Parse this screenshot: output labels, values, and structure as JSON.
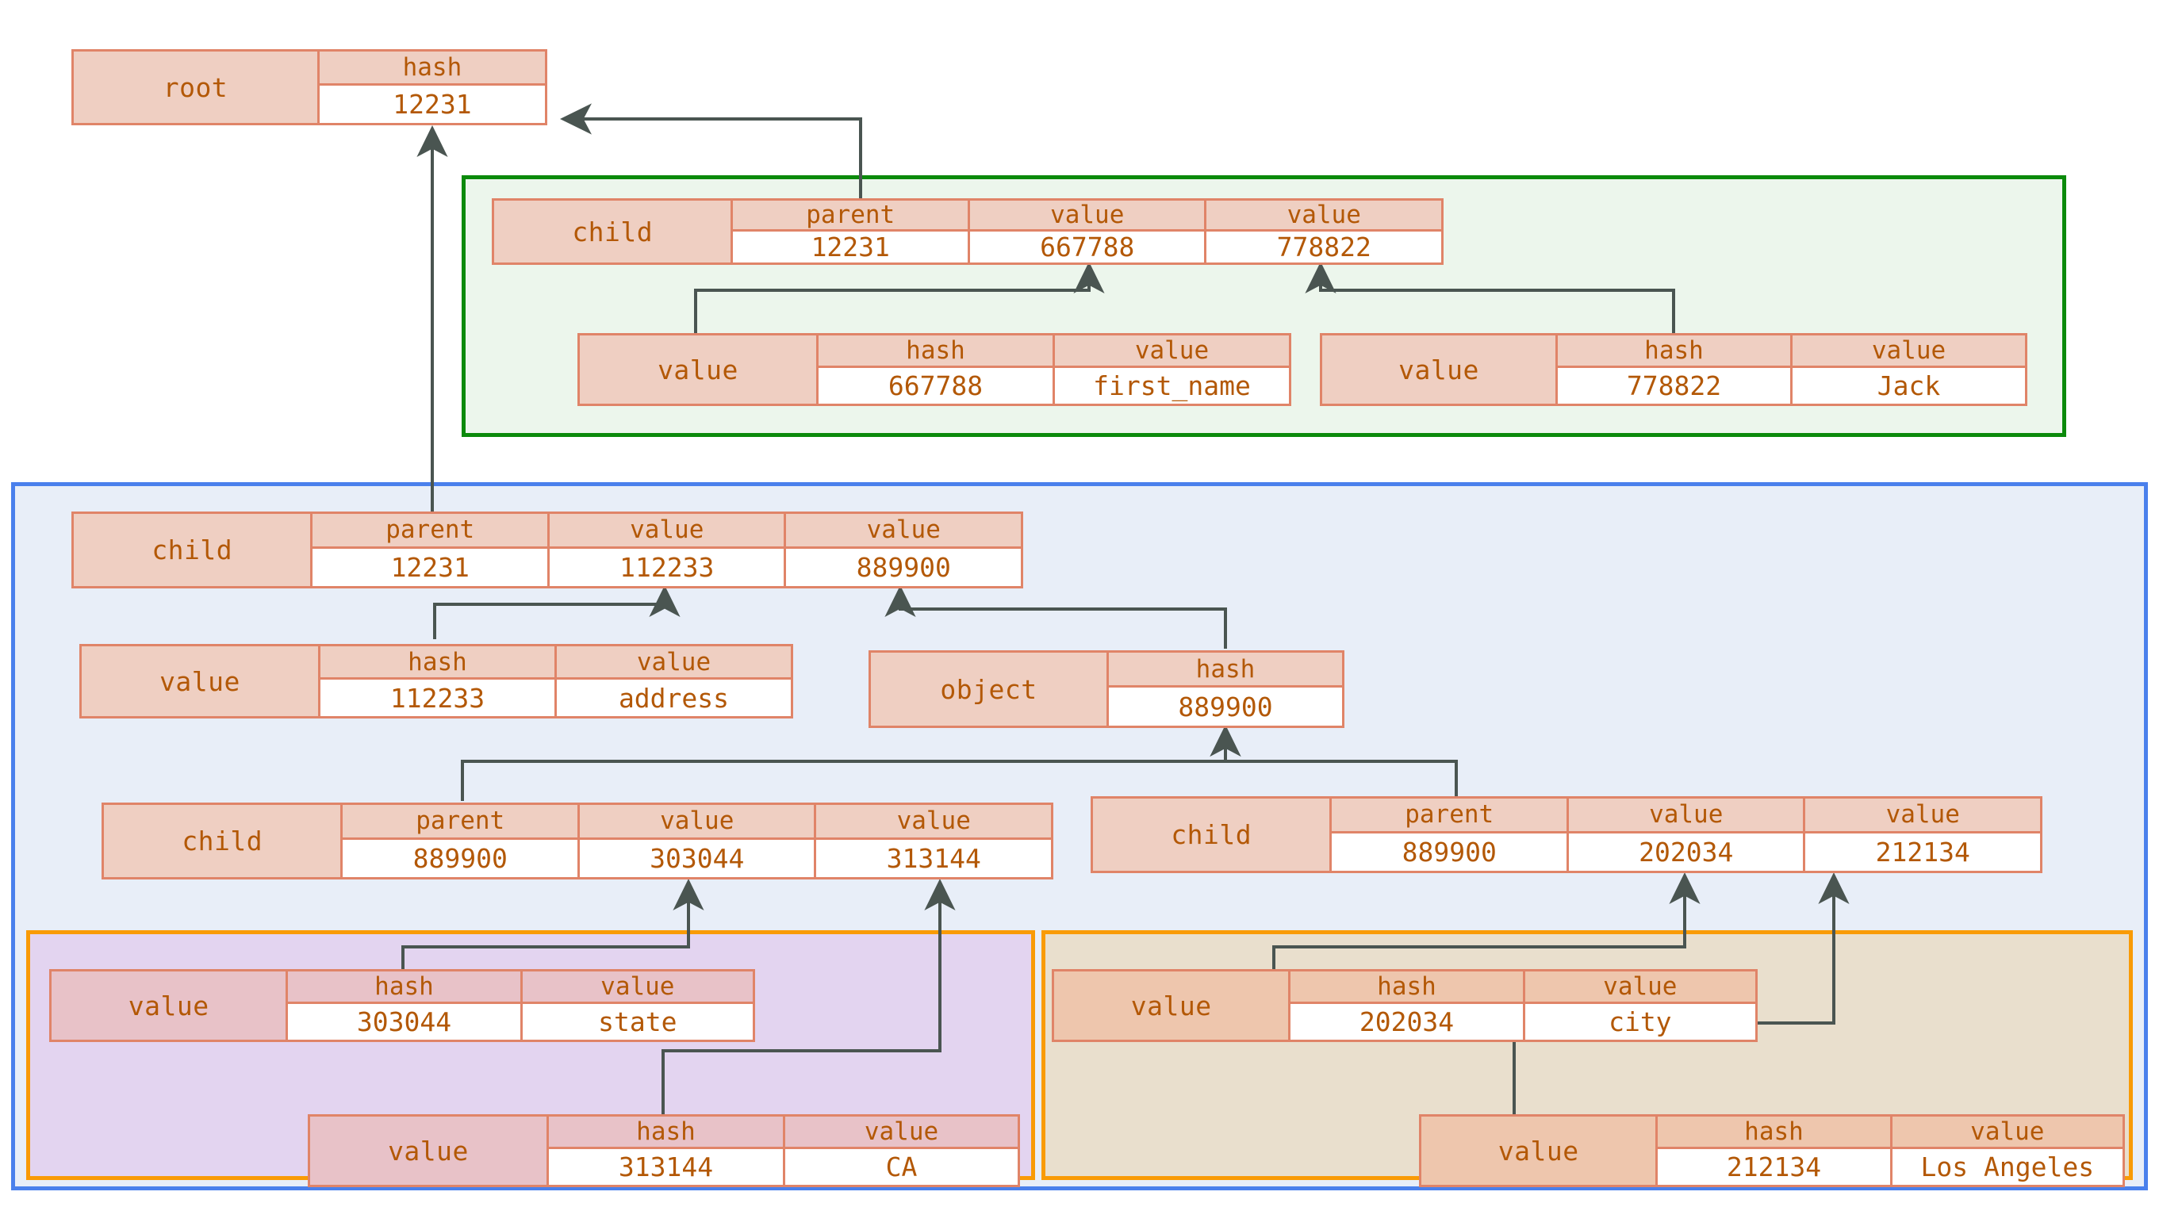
{
  "diagram": {
    "title": "nested-hash-tree-structure",
    "colors": {
      "node_fill": "#efcfc2",
      "node_border": "#e08468",
      "node_text": "#b35806",
      "value_fill": "#ffffff",
      "green_group_border": "#0b8a0b",
      "green_group_fill": "#ecf6ec",
      "blue_group_border": "#4a80ec",
      "blue_group_fill": "#e8eef8",
      "orange_group_border": "#f99b06",
      "purple_group_fill": "#e3d4f0",
      "tan_group_fill": "#e9dfcd",
      "edge_color": "#4a5551"
    },
    "nodes": {
      "root": {
        "label": "root",
        "fields": [
          {
            "key": "hash",
            "value": "12231"
          }
        ]
      },
      "child_first_name": {
        "label": "child",
        "fields": [
          {
            "key": "parent",
            "value": "12231"
          },
          {
            "key": "value",
            "value": "667788"
          },
          {
            "key": "value",
            "value": "778822"
          }
        ]
      },
      "value_first_name_key": {
        "label": "value",
        "fields": [
          {
            "key": "hash",
            "value": "667788"
          },
          {
            "key": "value",
            "value": "first_name"
          }
        ]
      },
      "value_jack": {
        "label": "value",
        "fields": [
          {
            "key": "hash",
            "value": "778822"
          },
          {
            "key": "value",
            "value": "Jack"
          }
        ]
      },
      "child_address": {
        "label": "child",
        "fields": [
          {
            "key": "parent",
            "value": "12231"
          },
          {
            "key": "value",
            "value": "112233"
          },
          {
            "key": "value",
            "value": "889900"
          }
        ]
      },
      "value_address_key": {
        "label": "value",
        "fields": [
          {
            "key": "hash",
            "value": "112233"
          },
          {
            "key": "value",
            "value": "address"
          }
        ]
      },
      "object_address": {
        "label": "object",
        "fields": [
          {
            "key": "hash",
            "value": "889900"
          }
        ]
      },
      "child_state": {
        "label": "child",
        "fields": [
          {
            "key": "parent",
            "value": "889900"
          },
          {
            "key": "value",
            "value": "303044"
          },
          {
            "key": "value",
            "value": "313144"
          }
        ]
      },
      "child_city": {
        "label": "child",
        "fields": [
          {
            "key": "parent",
            "value": "889900"
          },
          {
            "key": "value",
            "value": "202034"
          },
          {
            "key": "value",
            "value": "212134"
          }
        ]
      },
      "value_state_key": {
        "label": "value",
        "fields": [
          {
            "key": "hash",
            "value": "303044"
          },
          {
            "key": "value",
            "value": "state"
          }
        ]
      },
      "value_ca": {
        "label": "value",
        "fields": [
          {
            "key": "hash",
            "value": "313144"
          },
          {
            "key": "value",
            "value": "CA"
          }
        ]
      },
      "value_city_key": {
        "label": "value",
        "fields": [
          {
            "key": "hash",
            "value": "202034"
          },
          {
            "key": "value",
            "value": "city"
          }
        ]
      },
      "value_los_angeles": {
        "label": "value",
        "fields": [
          {
            "key": "hash",
            "value": "212134"
          },
          {
            "key": "value",
            "value": "Los Angeles"
          }
        ]
      }
    }
  }
}
